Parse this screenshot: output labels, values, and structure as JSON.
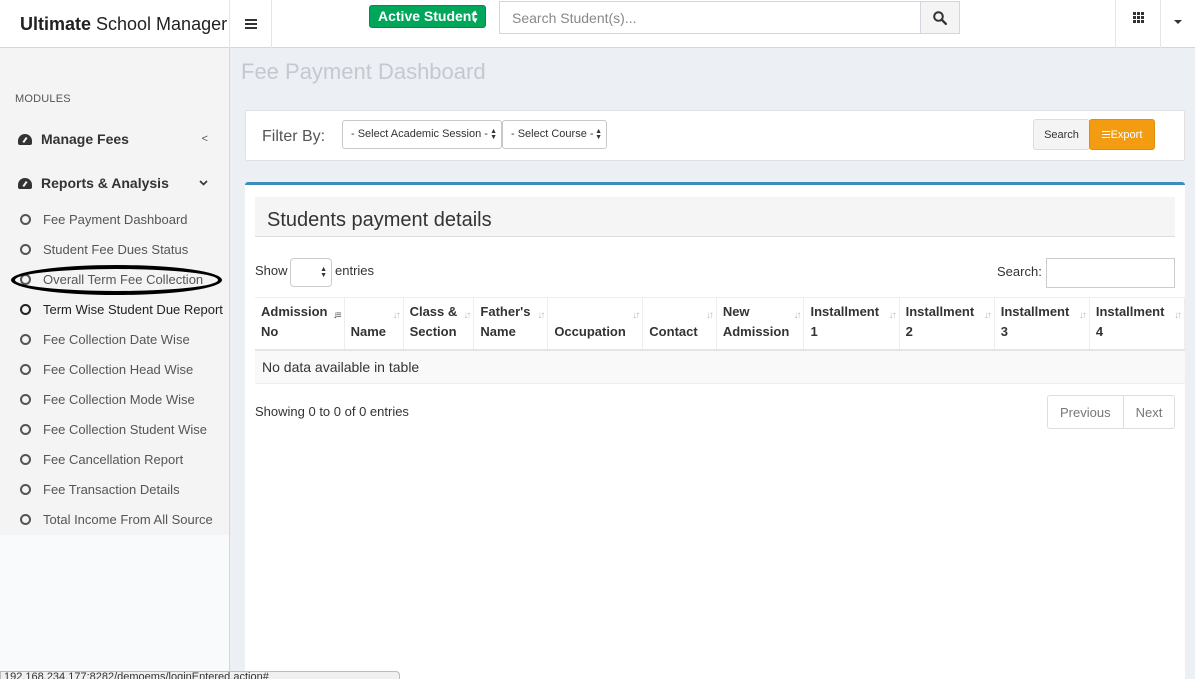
{
  "brand": {
    "bold": "Ultimate",
    "rest": "School Manager"
  },
  "topbar": {
    "active_student": "Active Student",
    "search_placeholder": "Search Student(s)..."
  },
  "sidebar": {
    "modules_label": "MODULES",
    "manage_fees": "Manage Fees",
    "reports": "Reports & Analysis",
    "items": [
      "Fee Payment Dashboard",
      "Student Fee Dues Status",
      "Overall Term Fee Collection",
      "Term Wise Student Due Report",
      "Fee Collection Date Wise",
      "Fee Collection Head Wise",
      "Fee Collection Mode Wise",
      "Fee Collection Student Wise",
      "Fee Cancellation Report",
      "Fee Transaction Details",
      "Total Income From All Source"
    ]
  },
  "page": {
    "title": "Fee Payment Dashboard",
    "filter_label": "Filter By:",
    "session_select": "- Select Academic Session -",
    "course_select": "- Select Course -",
    "search_btn": "Search",
    "export_btn": "Export"
  },
  "table_box": {
    "title": "Students payment details",
    "show": "Show",
    "entries": "entries",
    "search_label": "Search:",
    "columns": [
      [
        "Admission",
        "No"
      ],
      [
        "",
        "Name"
      ],
      [
        "Class &",
        "Section"
      ],
      [
        "Father's",
        "Name"
      ],
      [
        "",
        "Occupation"
      ],
      [
        "",
        "Contact"
      ],
      [
        "New",
        "Admission"
      ],
      [
        "Installment",
        "1"
      ],
      [
        "Installment",
        "2"
      ],
      [
        "Installment",
        "3"
      ],
      [
        "Installment",
        "4"
      ]
    ],
    "empty": "No data available in table",
    "info": "Showing 0 to 0 of 0 entries",
    "previous": "Previous",
    "next": "Next"
  },
  "statusbar": "192.168.234.177:8282/demoems/loginEntered.action#",
  "colors": {
    "accent_blue": "#3c8dbc",
    "green": "#00a65a",
    "orange": "#f39c12"
  }
}
